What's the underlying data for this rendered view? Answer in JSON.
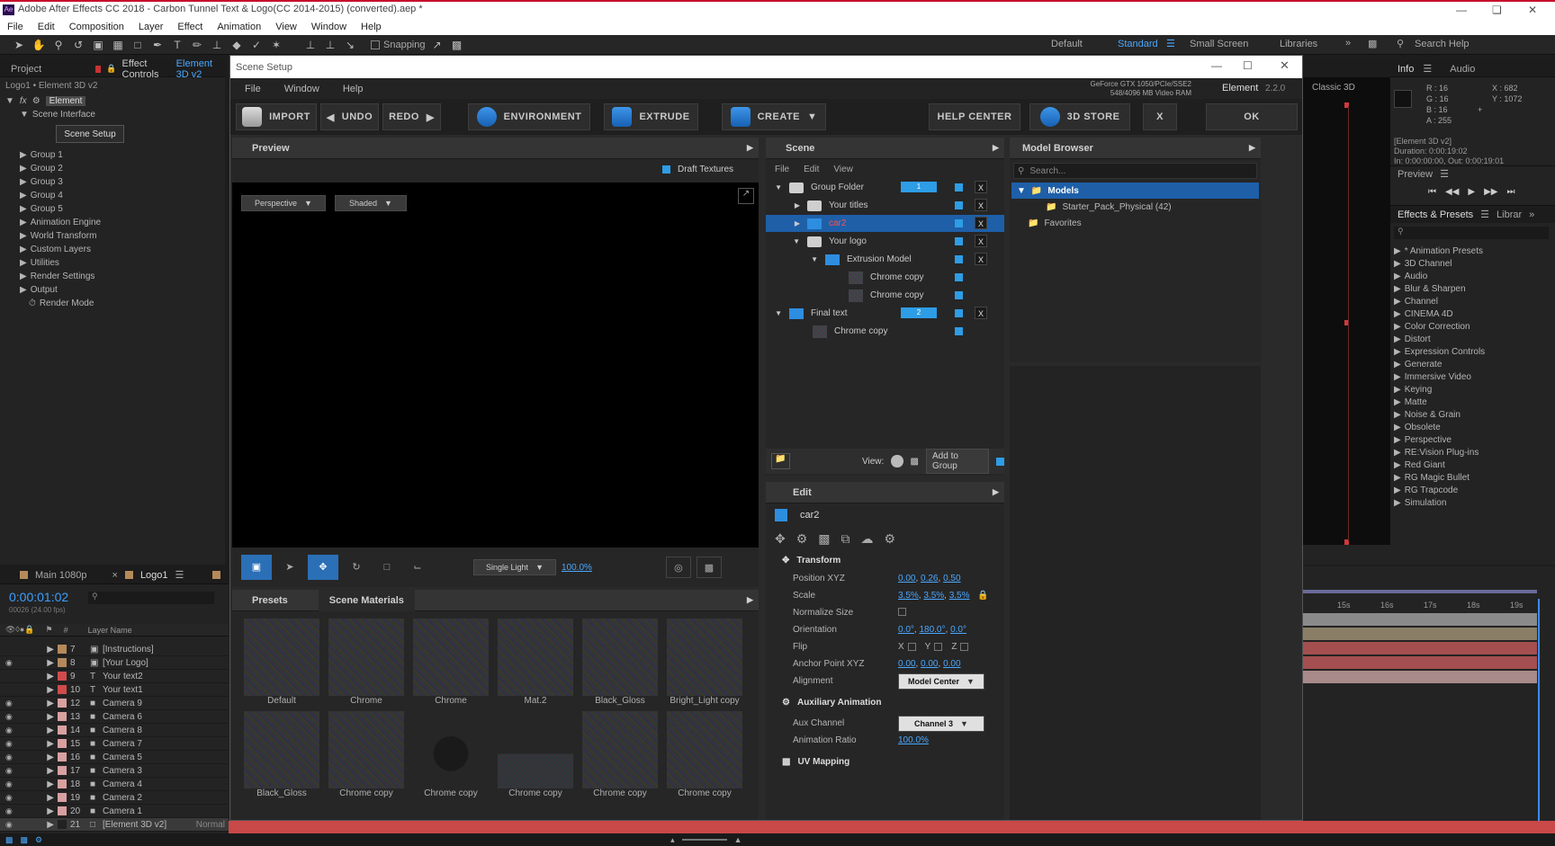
{
  "app": {
    "title": "Adobe After Effects CC 2018 - Carbon Tunnel Text & Logo(CC 2014-2015) (converted).aep *",
    "icon": "Ae",
    "menu": [
      "File",
      "Edit",
      "Composition",
      "Layer",
      "Effect",
      "Animation",
      "View",
      "Window",
      "Help"
    ],
    "toolbar": {
      "snapping_label": "Snapping",
      "workspaces": [
        "Default",
        "Standard",
        "Small Screen",
        "Libraries"
      ],
      "search_placeholder": "Search Help"
    }
  },
  "left_panel": {
    "tabs": [
      "Project",
      "Effect Controls",
      "Element 3D v2"
    ],
    "breadcrumb": "Logo1 • Element 3D v2",
    "fx_label": "fx",
    "effect_name": "Element",
    "scene_interface_label": "Scene Interface",
    "scene_setup_button": "Scene Setup",
    "tree": [
      "Group 1",
      "Group 2",
      "Group 3",
      "Group 4",
      "Group 5",
      "Animation Engine",
      "World Transform",
      "Custom Layers",
      "Utilities",
      "Render Settings",
      "Output"
    ],
    "render_mode": "Render Mode"
  },
  "timeline": {
    "tabs": [
      "Main 1080p",
      "Logo1"
    ],
    "timecode": "0:00:01:02",
    "fps": "00026 (24.00 fps)",
    "column_number": "#",
    "column_layer_name": "Layer Name",
    "layers": [
      {
        "num": "7",
        "type": "comp",
        "name": "[Instructions]",
        "color": "#b58a5b",
        "visible": false
      },
      {
        "num": "8",
        "type": "comp",
        "name": "[Your Logo]",
        "color": "#b58a5b",
        "visible": true
      },
      {
        "num": "9",
        "type": "T",
        "name": "Your text2",
        "color": "#d04b4b",
        "visible": false
      },
      {
        "num": "10",
        "type": "T",
        "name": "Your text1",
        "color": "#d04b4b",
        "visible": false
      },
      {
        "num": "12",
        "type": "cam",
        "name": "Camera 9",
        "color": "#d9a0a0",
        "visible": true
      },
      {
        "num": "13",
        "type": "cam",
        "name": "Camera 6",
        "color": "#d9a0a0",
        "visible": true
      },
      {
        "num": "14",
        "type": "cam",
        "name": "Camera 8",
        "color": "#d9a0a0",
        "visible": true
      },
      {
        "num": "15",
        "type": "cam",
        "name": "Camera 7",
        "color": "#d9a0a0",
        "visible": true
      },
      {
        "num": "16",
        "type": "cam",
        "name": "Camera 5",
        "color": "#d9a0a0",
        "visible": true
      },
      {
        "num": "17",
        "type": "cam",
        "name": "Camera 3",
        "color": "#d9a0a0",
        "visible": true
      },
      {
        "num": "18",
        "type": "cam",
        "name": "Camera 4",
        "color": "#d9a0a0",
        "visible": true
      },
      {
        "num": "19",
        "type": "cam",
        "name": "Camera 2",
        "color": "#d9a0a0",
        "visible": true
      },
      {
        "num": "20",
        "type": "cam",
        "name": "Camera 1",
        "color": "#d9a0a0",
        "visible": true
      },
      {
        "num": "21",
        "type": "solid",
        "name": "[Element 3D v2]",
        "color": "#222222",
        "visible": true
      }
    ],
    "mode_label": "Normal",
    "ruler": [
      "15s",
      "16s",
      "17s",
      "18s",
      "19s"
    ]
  },
  "right_panel": {
    "comp_label": "Classic 3D",
    "info_tabs": [
      "Info",
      "Audio"
    ],
    "info": {
      "r": "R : 16",
      "g": "G : 16",
      "b": "B : 16",
      "a": "A : 255",
      "x": "X : 682",
      "y": "Y : 1072"
    },
    "layer_info": [
      "[Element 3D v2]",
      "Duration: 0:00:19:02",
      "In: 0:00:00:00, Out: 0:00:19:01"
    ],
    "preview_label": "Preview",
    "effects_tabs": [
      "Effects & Presets",
      "Librar"
    ],
    "effects": [
      "* Animation Presets",
      "3D Channel",
      "Audio",
      "Blur & Sharpen",
      "Channel",
      "CINEMA 4D",
      "Color Correction",
      "Distort",
      "Expression Controls",
      "Generate",
      "Immersive Video",
      "Keying",
      "Matte",
      "Noise & Grain",
      "Obsolete",
      "Perspective",
      "RE:Vision Plug-ins",
      "Red Giant",
      "RG Magic Bullet",
      "RG Trapcode",
      "Simulation"
    ]
  },
  "scene_setup": {
    "title": "Scene Setup",
    "menu": [
      "File",
      "Window",
      "Help"
    ],
    "gpu": "GeForce GTX 1050/PCIe/SSE2",
    "vram": "548/4096 MB Video RAM",
    "plugin_name": "Element",
    "plugin_version": "2.2.0",
    "buttons": {
      "import": "IMPORT",
      "undo": "UNDO",
      "redo": "REDO",
      "environment": "ENVIRONMENT",
      "extrude": "EXTRUDE",
      "create": "CREATE",
      "help": "HELP CENTER",
      "store": "3D STORE",
      "close": "X",
      "ok": "OK"
    },
    "preview": {
      "title": "Preview",
      "draft_textures": "Draft Textures",
      "view_mode": "Perspective",
      "shading": "Shaded",
      "light": "Single Light",
      "zoom": "100.0%"
    },
    "scene": {
      "title": "Scene",
      "menu": [
        "File",
        "Edit",
        "View"
      ],
      "items": [
        {
          "label": "Group Folder",
          "indent": 0,
          "kind": "folder",
          "expanded": true,
          "group_num": "1",
          "x": true
        },
        {
          "label": "Your titles",
          "indent": 1,
          "kind": "folder",
          "expanded": false,
          "x": true
        },
        {
          "label": "car2",
          "indent": 1,
          "kind": "model",
          "expanded": false,
          "x": true,
          "selected": true
        },
        {
          "label": "Your logo",
          "indent": 1,
          "kind": "folder",
          "expanded": true,
          "x": true
        },
        {
          "label": "Extrusion Model",
          "indent": 2,
          "kind": "extrude",
          "expanded": true,
          "x": true
        },
        {
          "label": "Chrome copy",
          "indent": 3,
          "kind": "material",
          "x": false
        },
        {
          "label": "Chrome copy",
          "indent": 3,
          "kind": "material",
          "x": false
        },
        {
          "label": "Final text",
          "indent": 0,
          "kind": "extrude",
          "expanded": true,
          "group_num": "2",
          "x": true
        },
        {
          "label": "Chrome copy",
          "indent": 1,
          "kind": "material",
          "x": false
        }
      ],
      "view_label": "View:",
      "add_to_group": "Add to Group"
    },
    "model_browser": {
      "title": "Model Browser",
      "search_placeholder": "Search...",
      "models_label": "Models",
      "starter_pack": "Starter_Pack_Physical (42)",
      "favorites": "Favorites"
    },
    "materials": {
      "tabs": [
        "Presets",
        "Scene Materials"
      ],
      "items": [
        "Default",
        "Chrome",
        "Chrome",
        "Mat.2",
        "Black_Gloss",
        "Bright_Light copy",
        "Black_Gloss",
        "Chrome copy",
        "Chrome copy",
        "Chrome copy",
        "Chrome copy",
        "Chrome copy"
      ]
    },
    "edit": {
      "title": "Edit",
      "object": "car2",
      "transform_label": "Transform",
      "position_label": "Position XYZ",
      "position": [
        "0.00",
        "0.26",
        "0.50"
      ],
      "scale_label": "Scale",
      "scale": [
        "3.5%",
        "3.5%",
        "3.5%"
      ],
      "normalize_label": "Normalize Size",
      "orientation_label": "Orientation",
      "orientation": [
        "0.0°",
        "180.0°",
        "0.0°"
      ],
      "flip_label": "Flip",
      "flip_axes": [
        "X",
        "Y",
        "Z"
      ],
      "anchor_label": "Anchor Point XYZ",
      "anchor": [
        "0.00",
        "0.00",
        "0.00"
      ],
      "alignment_label": "Alignment",
      "alignment": "Model Center",
      "aux_label": "Auxiliary Animation",
      "aux_channel_label": "Aux Channel",
      "aux_channel": "Channel 3",
      "anim_ratio_label": "Animation Ratio",
      "anim_ratio": "100.0%",
      "uv_label": "UV Mapping"
    }
  }
}
